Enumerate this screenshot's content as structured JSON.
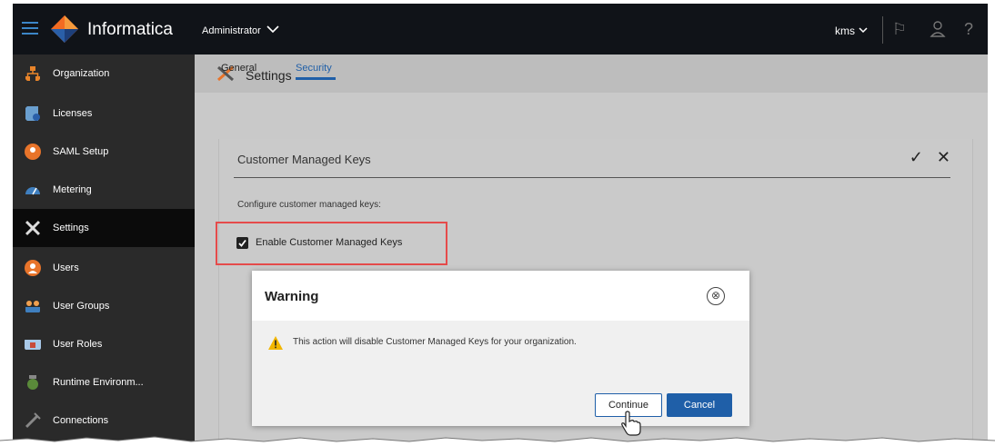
{
  "app": {
    "brand": "Informatica",
    "service": "Administrator",
    "user": "kms"
  },
  "sidebar": {
    "items": [
      {
        "label": "Organization",
        "icon": "org-chart-icon",
        "color": "#e8842a"
      },
      {
        "label": "Licenses",
        "icon": "license-icon",
        "color": "#6a9fcf"
      },
      {
        "label": "SAML Setup",
        "icon": "saml-icon",
        "color": "#e8742a"
      },
      {
        "label": "Metering",
        "icon": "gauge-icon",
        "color": "#3f7fbf"
      },
      {
        "label": "Settings",
        "icon": "wrench-screwdriver-icon",
        "color": "#dddddd",
        "active": true
      },
      {
        "label": "Users",
        "icon": "user-icon",
        "color": "#e8742a"
      },
      {
        "label": "User Groups",
        "icon": "user-group-icon",
        "color": "#f0a050"
      },
      {
        "label": "User Roles",
        "icon": "user-role-icon",
        "color": "#c84a3a"
      },
      {
        "label": "Runtime Environm...",
        "icon": "runtime-icon",
        "color": "#5a8a3a"
      },
      {
        "label": "Connections",
        "icon": "plug-icon",
        "color": "#888888"
      }
    ]
  },
  "main": {
    "header_title": "Settings",
    "tabs": [
      {
        "label": "General",
        "active": false
      },
      {
        "label": "Security",
        "active": true
      }
    ],
    "panel": {
      "title": "Customer Managed Keys",
      "description": "Configure customer managed keys:",
      "checkbox_label": "Enable Customer Managed Keys",
      "checkbox_checked": true,
      "accept_glyph": "✓",
      "close_glyph": "✕"
    }
  },
  "dialog": {
    "title": "Warning",
    "close_glyph": "⊗",
    "message": "This action will disable Customer Managed Keys for your organization.",
    "continue_label": "Continue",
    "cancel_label": "Cancel"
  },
  "topbar_glyphs": {
    "flag": "⚐",
    "help": "?"
  },
  "colors": {
    "accent": "#1f5fa8",
    "highlight": "#e54b4b",
    "warning": "#f2b600"
  }
}
